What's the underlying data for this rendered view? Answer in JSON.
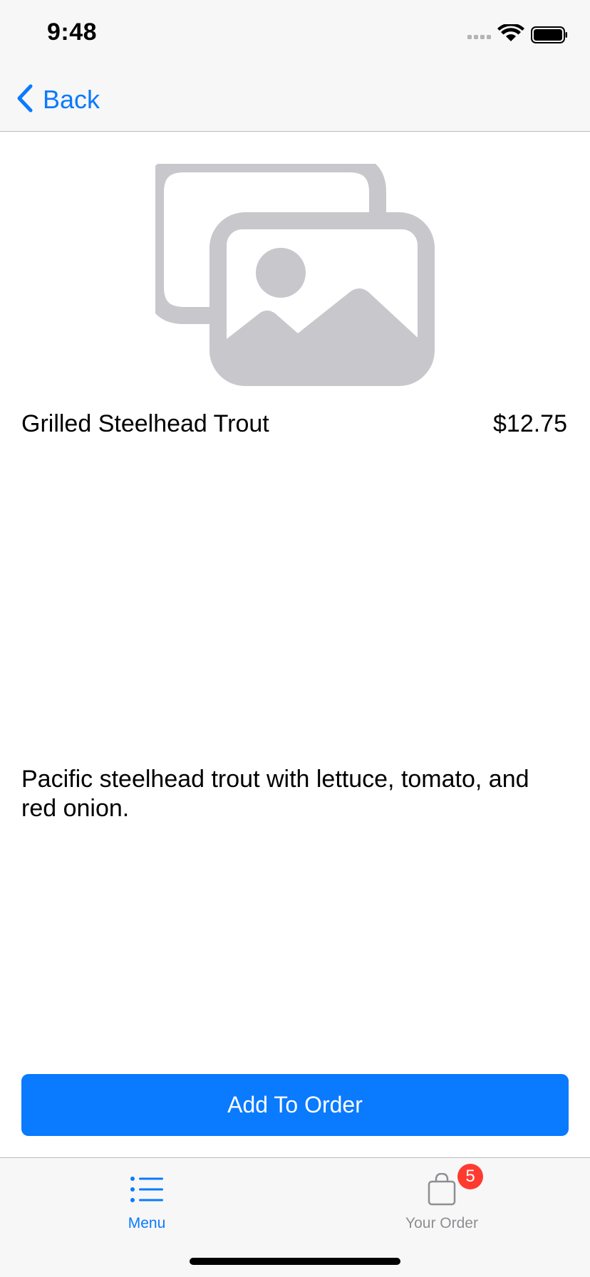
{
  "status_bar": {
    "time": "9:48",
    "icons": [
      "cellular-signal-icon",
      "wifi-icon",
      "battery-icon"
    ]
  },
  "nav_bar": {
    "back_label": "Back",
    "back_icon": "chevron-left-icon"
  },
  "item": {
    "image_icon": "photo-stack-placeholder-icon",
    "name": "Grilled Steelhead Trout",
    "price": "$12.75",
    "description": "Pacific steelhead trout with lettuce, tomato, and red onion."
  },
  "actions": {
    "add_to_order_label": "Add To Order"
  },
  "tab_bar": {
    "tabs": [
      {
        "label": "Menu",
        "icon": "list-bullet-icon",
        "selected": true
      },
      {
        "label": "Your Order",
        "icon": "bag-icon",
        "badge": "5",
        "selected": false
      }
    ]
  },
  "colors": {
    "accent": "#0a7aff",
    "inactive": "#8e8e93",
    "badge": "#ff3b30",
    "bar_background": "#f7f7f7",
    "placeholder": "#c7c7cc"
  }
}
